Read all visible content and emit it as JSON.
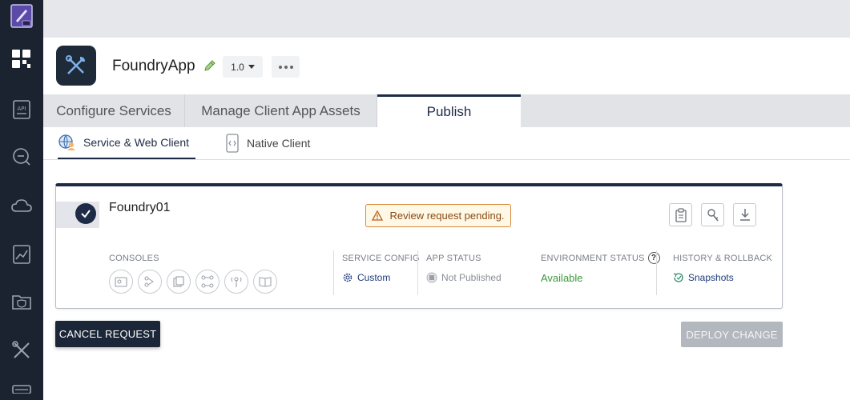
{
  "rail": {
    "items": [
      {
        "icon": "app-logo-icon"
      },
      {
        "icon": "dashboard-icon"
      },
      {
        "icon": "api-icon"
      },
      {
        "icon": "chat-icon"
      },
      {
        "icon": "cloud-icon"
      },
      {
        "icon": "analytics-icon"
      },
      {
        "icon": "security-folder-icon"
      },
      {
        "icon": "tools-icon"
      },
      {
        "icon": "server-icon"
      }
    ]
  },
  "header": {
    "app_name": "FoundryApp",
    "version": "1.0",
    "logo_icon": "tools-icon"
  },
  "main_tabs": [
    {
      "label": "Configure Services",
      "active": false
    },
    {
      "label": "Manage Client App Assets",
      "active": false
    },
    {
      "label": "Publish",
      "active": true
    }
  ],
  "sub_tabs": [
    {
      "label": "Service & Web Client",
      "active": true,
      "icon": "globe-user-icon"
    },
    {
      "label": "Native Client",
      "active": false,
      "icon": "mobile-code-icon"
    }
  ],
  "environment_card": {
    "name": "Foundry01",
    "badge": "Review request pending.",
    "sections": {
      "consoles_label": "CONSOLES",
      "service_config_label": "SERVICE CONFIG",
      "service_config_value": "Custom",
      "app_status_label": "APP STATUS",
      "app_status_value": "Not Published",
      "environment_status_label": "ENVIRONMENT STATUS",
      "environment_status_value": "Available",
      "history_label": "HISTORY & ROLLBACK",
      "history_value": "Snapshots"
    },
    "console_icons": [
      "identity-console-icon",
      "integration-console-icon",
      "objects-console-icon",
      "orchestration-console-icon",
      "messaging-console-icon",
      "reports-console-icon"
    ],
    "actions": [
      "clipboard-icon",
      "key-icon",
      "download-icon"
    ],
    "help": "?"
  },
  "footer": {
    "cancel_label": "CANCEL REQUEST",
    "deploy_label": "DEPLOY CHANGE"
  },
  "colors": {
    "navy": "#1e2b46",
    "rail": "#1b2330",
    "available": "#3a9a3a",
    "warning_border": "#d68a3c",
    "link": "#1e3a78"
  }
}
